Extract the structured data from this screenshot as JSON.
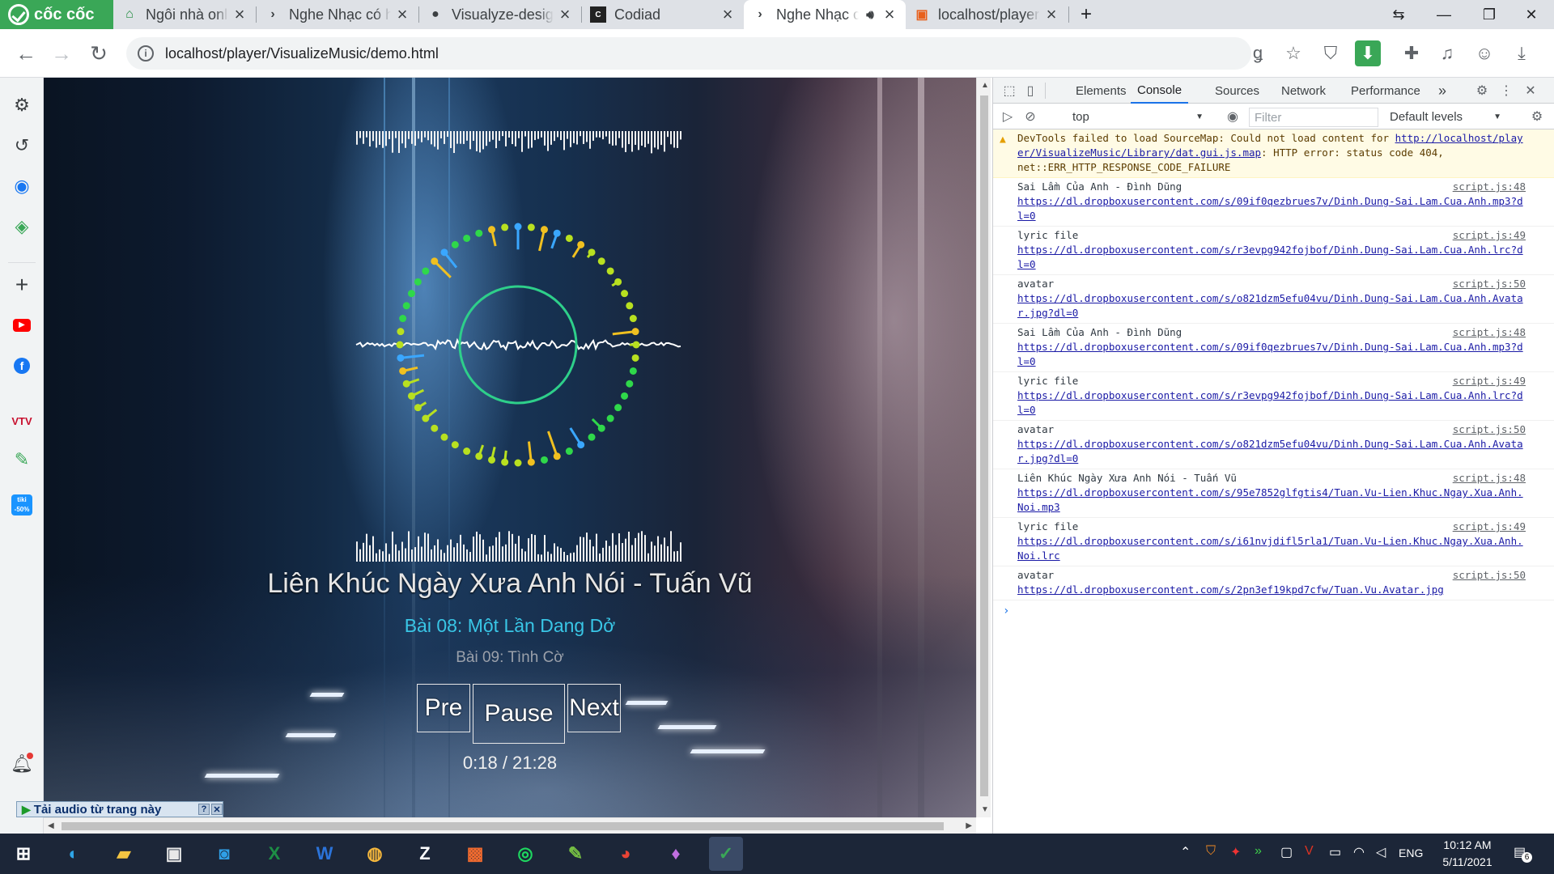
{
  "browser": {
    "logo_text": "cốc cốc",
    "tabs": [
      {
        "title": "Ngôi nhà online của bạ",
        "icon": "tab-favicon-house"
      },
      {
        "title": "Nghe Nhạc có hiệu ứng",
        "icon": "tab-favicon-chevron"
      },
      {
        "title": "Visualyze-design-your",
        "icon": "tab-favicon-github"
      },
      {
        "title": "Codiad",
        "icon": "tab-favicon-codiad"
      },
      {
        "title": "Nghe Nhạc có hiệu",
        "icon": "tab-favicon-chevron"
      },
      {
        "title": "localhost/player/Visual",
        "icon": "tab-favicon-html"
      }
    ],
    "new_tab": "+",
    "url": "localhost/player/VisualizeMusic/demo.html"
  },
  "player": {
    "song_title": "Liên Khúc Ngày Xưa Anh Nói - Tuấn Vũ",
    "lyric_current": "Bài 08: Một Lần Dang Dở",
    "lyric_next": "Bài 09: Tình Cờ",
    "buttons": {
      "prev": "Pre",
      "pause": "Pause",
      "next": "Next"
    },
    "time": "0:18 / 21:28"
  },
  "download_bar": {
    "label": "Tải audio từ trang này",
    "help": "?",
    "close": "✕"
  },
  "devtools": {
    "tabs": [
      "Elements",
      "Console",
      "Sources",
      "Network",
      "Performance"
    ],
    "active_tab": "Console",
    "more": "»",
    "context": "top",
    "filter_placeholder": "Filter",
    "levels": "Default levels",
    "messages": [
      {
        "type": "warn",
        "text": "DevTools failed to load SourceMap: Could not load content for ",
        "link": "http://localhost/player/VisualizeMusic/Library/dat.gui.js.map",
        "tail": ": HTTP error: status code 404, net::ERR_HTTP_RESPONSE_CODE_FAILURE",
        "src": ""
      },
      {
        "type": "log",
        "text": "Sai Lầm Của Anh - Đình Dũng",
        "link": "https://dl.dropboxusercontent.com/s/09if0qezbrues7v/Dinh.Dung-Sai.Lam.Cua.Anh.mp3?dl=0",
        "tail": "",
        "src": "script.js:48"
      },
      {
        "type": "log",
        "text": "lyric file",
        "link": "https://dl.dropboxusercontent.com/s/r3evpg942fojbof/Dinh.Dung-Sai.Lam.Cua.Anh.lrc?dl=0",
        "tail": "",
        "src": "script.js:49"
      },
      {
        "type": "log",
        "text": "avatar",
        "link": "https://dl.dropboxusercontent.com/s/o821dzm5efu04vu/Dinh.Dung-Sai.Lam.Cua.Anh.Avatar.jpg?dl=0",
        "tail": "",
        "src": "script.js:50"
      },
      {
        "type": "log",
        "text": "Sai Lầm Của Anh - Đình Dũng",
        "link": "https://dl.dropboxusercontent.com/s/09if0qezbrues7v/Dinh.Dung-Sai.Lam.Cua.Anh.mp3?dl=0",
        "tail": "",
        "src": "script.js:48"
      },
      {
        "type": "log",
        "text": "lyric file",
        "link": "https://dl.dropboxusercontent.com/s/r3evpg942fojbof/Dinh.Dung-Sai.Lam.Cua.Anh.lrc?dl=0",
        "tail": "",
        "src": "script.js:49"
      },
      {
        "type": "log",
        "text": "avatar",
        "link": "https://dl.dropboxusercontent.com/s/o821dzm5efu04vu/Dinh.Dung-Sai.Lam.Cua.Anh.Avatar.jpg?dl=0",
        "tail": "",
        "src": "script.js:50"
      },
      {
        "type": "log",
        "text": "Liên Khúc Ngày Xưa Anh Nói - Tuấn Vũ",
        "link": "https://dl.dropboxusercontent.com/s/95e7852glfgtis4/Tuan.Vu-Lien.Khuc.Ngay.Xua.Anh.Noi.mp3",
        "tail": "",
        "src": "script.js:48"
      },
      {
        "type": "log",
        "text": "lyric file",
        "link": "https://dl.dropboxusercontent.com/s/i61nvjdifl5rla1/Tuan.Vu-Lien.Khuc.Ngay.Xua.Anh.Noi.lrc",
        "tail": "",
        "src": "script.js:49"
      },
      {
        "type": "log",
        "text": "avatar",
        "link": "https://dl.dropboxusercontent.com/s/2pn3ef19kpd7cfw/Tuan.Vu.Avatar.jpg",
        "tail": "",
        "src": "script.js:50"
      }
    ],
    "prompt": "›"
  },
  "taskbar": {
    "lang": "ENG",
    "time": "10:12 AM",
    "date": "5/11/2021",
    "notification_count": "6"
  },
  "colors": {
    "accent_green": "#3aa757",
    "lyric_cyan": "#39c6e6",
    "console_link": "#1a1aa6",
    "warn_bg": "#fffbe5"
  }
}
